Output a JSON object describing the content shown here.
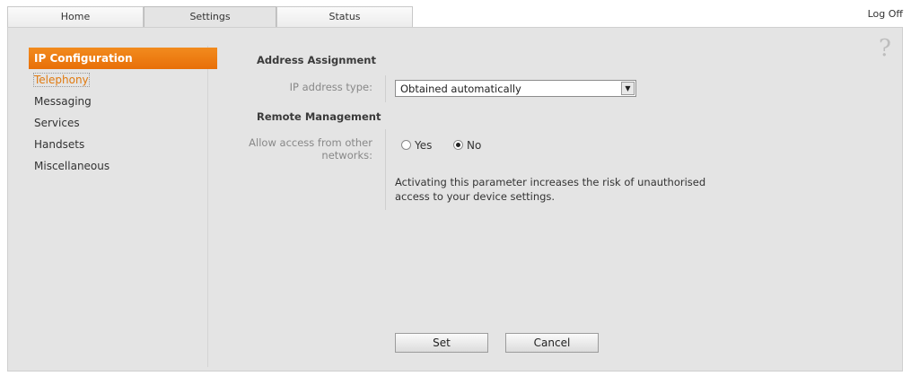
{
  "tabs": {
    "home": "Home",
    "settings": "Settings",
    "status": "Status"
  },
  "header": {
    "logoff": "Log Off"
  },
  "help_icon": "?",
  "sidebar": {
    "items": [
      {
        "label": "IP Configuration"
      },
      {
        "label": "Telephony"
      },
      {
        "label": "Messaging"
      },
      {
        "label": "Services"
      },
      {
        "label": "Handsets"
      },
      {
        "label": "Miscellaneous"
      }
    ]
  },
  "form": {
    "address_assignment_title": "Address Assignment",
    "ip_address_type_label": "IP address type:",
    "ip_address_type_value": "Obtained automatically",
    "remote_management_title": "Remote Management",
    "allow_access_label_line1": "Allow access from other",
    "allow_access_label_line2": "networks:",
    "radio_yes": "Yes",
    "radio_no": "No",
    "selected": "No",
    "note_line1": "Activating this parameter increases the risk of unauthorised",
    "note_line2": "access to your device settings."
  },
  "buttons": {
    "set": "Set",
    "cancel": "Cancel"
  },
  "colors": {
    "accent": "#ef7d12",
    "panel_bg": "#e4e4e4"
  }
}
